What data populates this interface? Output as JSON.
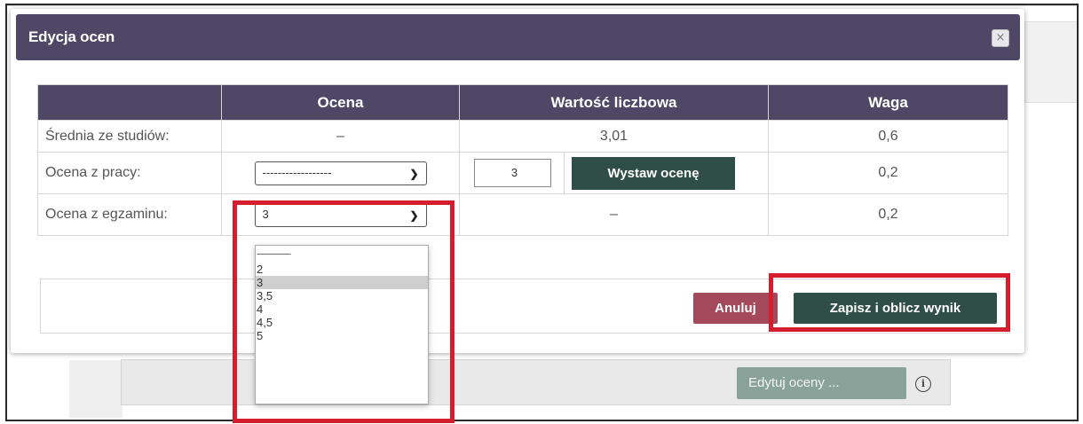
{
  "background": {
    "edit_grades_button": "Edytuj oceny ...",
    "info_icon": "i"
  },
  "dialog": {
    "title": "Edycja ocen",
    "close_icon": "×",
    "table": {
      "headers": [
        "",
        "Ocena",
        "Wartość liczbowa",
        "Waga"
      ],
      "rows": [
        {
          "label": "Średnia ze studiów:",
          "grade": "–",
          "value": "3,01",
          "weight": "0,6"
        },
        {
          "label": "Ocena z pracy:",
          "grade_select": "------------------",
          "value_input": "3",
          "action_button": "Wystaw ocenę",
          "weight": "0,2"
        },
        {
          "label": "Ocena z egzaminu:",
          "grade_select": "3",
          "value": "–",
          "weight": "0,2"
        }
      ]
    },
    "footer": {
      "cancel_button": "Anuluj",
      "save_button": "Zapisz i oblicz wynik"
    }
  },
  "dropdown": {
    "options": [
      "-------------------",
      "2",
      "3",
      "3,5",
      "4",
      "4,5",
      "5"
    ],
    "selected": "3"
  },
  "colors": {
    "header": "#4e4866",
    "primary_button": "#2f4f46",
    "cancel_button": "#a4485c",
    "highlight": "#d41e2d"
  }
}
